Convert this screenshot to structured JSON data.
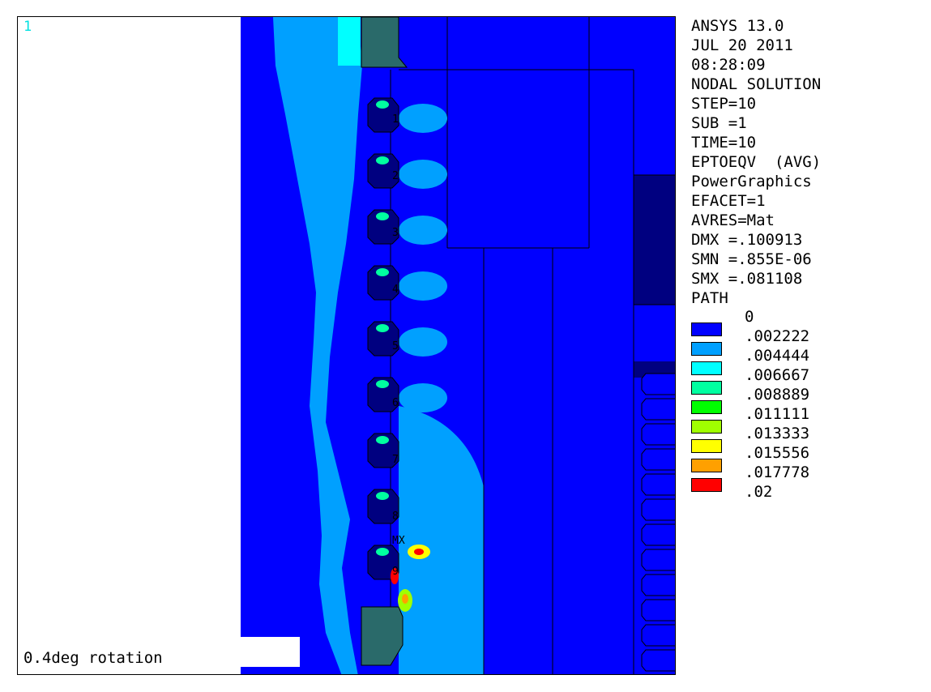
{
  "window_number": "1",
  "caption": "0.4deg rotation",
  "info_lines": [
    "ANSYS 13.0",
    "JUL 20 2011",
    "08:28:09",
    "NODAL SOLUTION",
    "STEP=10",
    "SUB =1",
    "TIME=10",
    "EPTOEQV  (AVG)",
    "PowerGraphics",
    "EFACET=1",
    "AVRES=Mat",
    "DMX =.100913",
    "SMN =.855E-06",
    "SMX =.081108",
    "PATH"
  ],
  "legend": {
    "levels": [
      "0",
      ".002222",
      ".004444",
      ".006667",
      ".008889",
      ".011111",
      ".013333",
      ".015556",
      ".017778",
      ".02"
    ],
    "colors": [
      "#0000ff",
      "#00a0ff",
      "#00ffff",
      "#00ffa0",
      "#00ff00",
      "#a0ff00",
      "#ffff00",
      "#ffa000",
      "#ff0000"
    ]
  },
  "path_labels": [
    "1",
    "2",
    "3",
    "4",
    "5",
    "6",
    "7",
    "8",
    "MX",
    "9"
  ],
  "palette": {
    "contour_dark_blue": "#0000ff",
    "contour_light": "#00a0ff",
    "navy_region": "#000080",
    "nut_steel": "#2a6a6a"
  }
}
